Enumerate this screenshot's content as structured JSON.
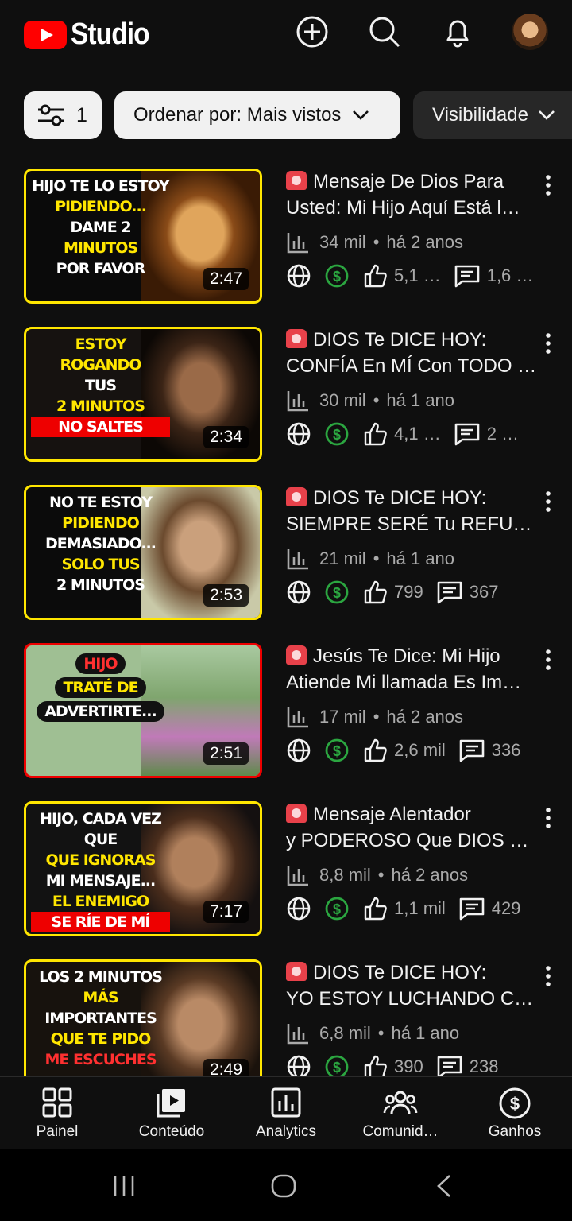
{
  "header": {
    "logo_text": "Studio",
    "icons": [
      "create-icon",
      "search-icon",
      "notifications-icon",
      "avatar"
    ]
  },
  "filters": {
    "filter_count": "1",
    "sort_label": "Ordenar por: Mais vistos",
    "visibility_label": "Visibilidade"
  },
  "videos": [
    {
      "thumb_text": [
        "HIJO TE LO ESTOY",
        "PIDIENDO...",
        "DAME 2",
        "MINUTOS",
        "POR FAVOR"
      ],
      "duration": "2:47",
      "title_l1": "Mensaje De Dios Para",
      "title_l2": "Usted: Mi Hijo Aquí Está l…",
      "views": "34 mil",
      "age": "há 2 anos",
      "likes": "5,1 …",
      "comments": "1,6 …"
    },
    {
      "thumb_text": [
        "ESTOY",
        "ROGANDO",
        "TUS",
        "2 MINUTOS",
        "NO SALTES"
      ],
      "duration": "2:34",
      "title_l1": "DIOS Te DICE HOY:",
      "title_l2": "CONFÍA En MÍ Con TODO …",
      "views": "30 mil",
      "age": "há 1 ano",
      "likes": "4,1 …",
      "comments": "2 …"
    },
    {
      "thumb_text": [
        "NO TE ESTOY",
        "PIDIENDO",
        "DEMASIADO...",
        "SOLO TUS",
        "2 MINUTOS"
      ],
      "duration": "2:53",
      "title_l1": "DIOS Te DICE HOY:",
      "title_l2": "SIEMPRE SERÉ Tu REFU…",
      "views": "21 mil",
      "age": "há 1 ano",
      "likes": "799",
      "comments": "367"
    },
    {
      "thumb_text": [
        "HIJO",
        "TRATÉ DE",
        "ADVERTIRTE..."
      ],
      "duration": "2:51",
      "title_l1": "Jesús Te Dice: Mi Hijo",
      "title_l2": "Atiende Mi llamada Es Im…",
      "views": "17 mil",
      "age": "há 2 anos",
      "likes": "2,6 mil",
      "comments": "336"
    },
    {
      "thumb_text": [
        "HIJO, CADA VEZ QUE",
        "QUE IGNORAS",
        "MI MENSAJE...",
        "EL ENEMIGO",
        "SE RÍE DE MÍ"
      ],
      "duration": "7:17",
      "title_l1": "Mensaje Alentador",
      "title_l2": "y PODEROSO Que DIOS Q…",
      "views": "8,8 mil",
      "age": "há 2 anos",
      "likes": "1,1 mil",
      "comments": "429"
    },
    {
      "thumb_text": [
        "LOS 2 MINUTOS",
        "MÁS",
        "IMPORTANTES",
        "QUE TE PIDO",
        "ME ESCUCHES"
      ],
      "duration": "2:49",
      "title_l1": "DIOS Te DICE HOY:",
      "title_l2": "YO ESTOY LUCHANDO C…",
      "views": "6,8 mil",
      "age": "há 1 ano",
      "likes": "390",
      "comments": "238"
    }
  ],
  "bottom_nav": [
    {
      "label": "Painel",
      "icon": "dashboard-icon"
    },
    {
      "label": "Conteúdo",
      "icon": "content-icon"
    },
    {
      "label": "Analytics",
      "icon": "analytics-icon"
    },
    {
      "label": "Comunid…",
      "icon": "community-icon"
    },
    {
      "label": "Ganhos",
      "icon": "earn-icon"
    }
  ],
  "colors": {
    "background": "#0f0f0f",
    "brand_red": "#ff0000",
    "monetized_green": "#2ba640",
    "chip_light": "#f1f1f1",
    "chip_dark": "#272727",
    "thumb_border_yellow": "#ffe600",
    "thumb_border_red": "#e00000"
  }
}
